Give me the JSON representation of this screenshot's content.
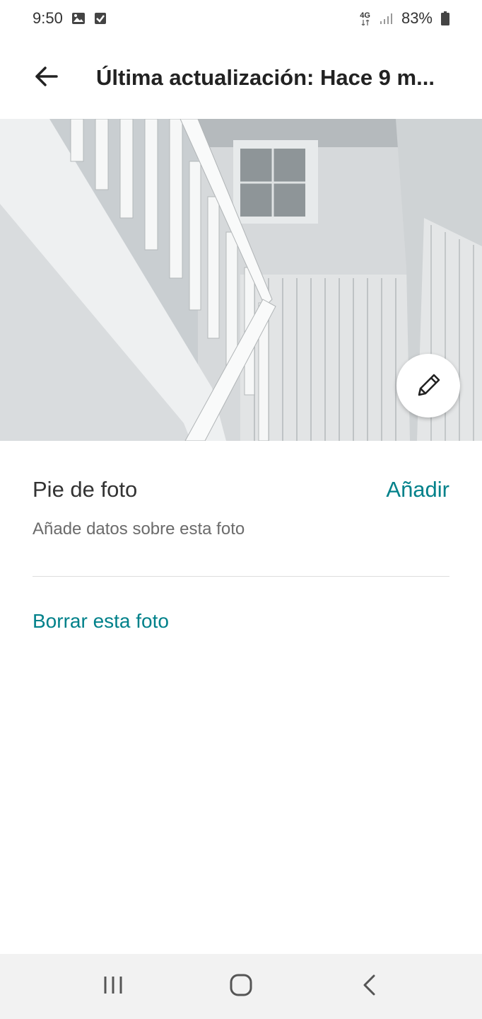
{
  "status_bar": {
    "time": "9:50",
    "network": "4G",
    "battery": "83%",
    "icons": [
      "image-icon",
      "check-box-icon",
      "signal-icon",
      "battery-icon"
    ]
  },
  "app_bar": {
    "title": "Última actualización: Hace 9 m...",
    "back_icon": "arrow-left-icon"
  },
  "photo": {
    "description_icon": "edit-pencil-icon"
  },
  "caption": {
    "title": "Pie de foto",
    "add_label": "Añadir",
    "subtitle": "Añade datos sobre esta foto"
  },
  "actions": {
    "delete_label": "Borrar esta foto"
  },
  "nav_bar": {
    "icons": [
      "recent-apps-icon",
      "home-icon",
      "back-icon"
    ]
  },
  "colors": {
    "accent": "#00818a",
    "text_primary": "#222222",
    "text_secondary": "#6b6b6b",
    "nav_bg": "#f2f2f2"
  }
}
